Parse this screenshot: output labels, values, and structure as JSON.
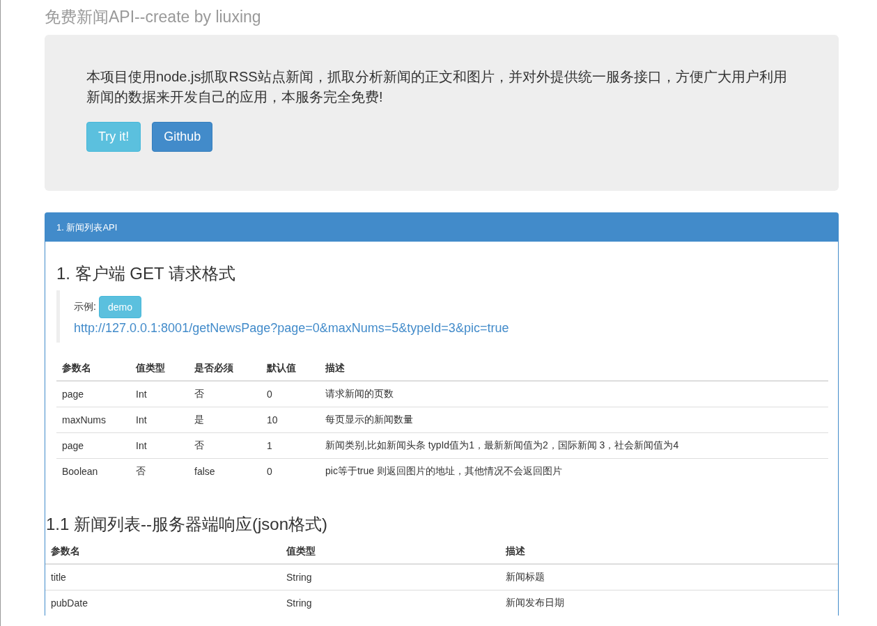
{
  "page_title": "免费新闻API--create by liuxing",
  "intro": {
    "text": "本项目使用node.js抓取RSS站点新闻，抓取分析新闻的正文和图片，并对外提供统一服务接口，方便广大用户利用新闻的数据来开发自己的应用，本服务完全免费!",
    "buttons": [
      {
        "label": "Try it!",
        "kind": "info"
      },
      {
        "label": "Github",
        "kind": "primary"
      }
    ]
  },
  "panel": {
    "title": "1. 新闻列表API",
    "request_heading": "1. 客户端 GET 请求格式",
    "example": {
      "label": "示例:",
      "button": "demo",
      "url": "http://127.0.0.1:8001/getNewsPage?page=0&maxNums=5&typeId=3&pic=true"
    },
    "request_table": {
      "columns": [
        "参数名",
        "值类型",
        "是否必须",
        "默认值",
        "描述"
      ],
      "rows": [
        [
          "page",
          "Int",
          "否",
          "0",
          "请求新闻的页数"
        ],
        [
          "maxNums",
          "Int",
          "是",
          "10",
          "每页显示的新闻数量"
        ],
        [
          "page",
          "Int",
          "否",
          "1",
          "新闻类别,比如新闻头条 typId值为1，最新新闻值为2，国际新闻 3，社会新闻值为4"
        ],
        [
          "Boolean",
          "否",
          "false",
          "0",
          "pic等于true 则返回图片的地址，其他情况不会返回图片"
        ]
      ]
    },
    "response_heading": "1.1 新闻列表--服务器端响应(json格式)",
    "response_table": {
      "columns": [
        "参数名",
        "值类型",
        "描述"
      ],
      "rows": [
        [
          "title",
          "String",
          "新闻标题"
        ],
        [
          "pubDate",
          "String",
          "新闻发布日期"
        ]
      ]
    }
  }
}
